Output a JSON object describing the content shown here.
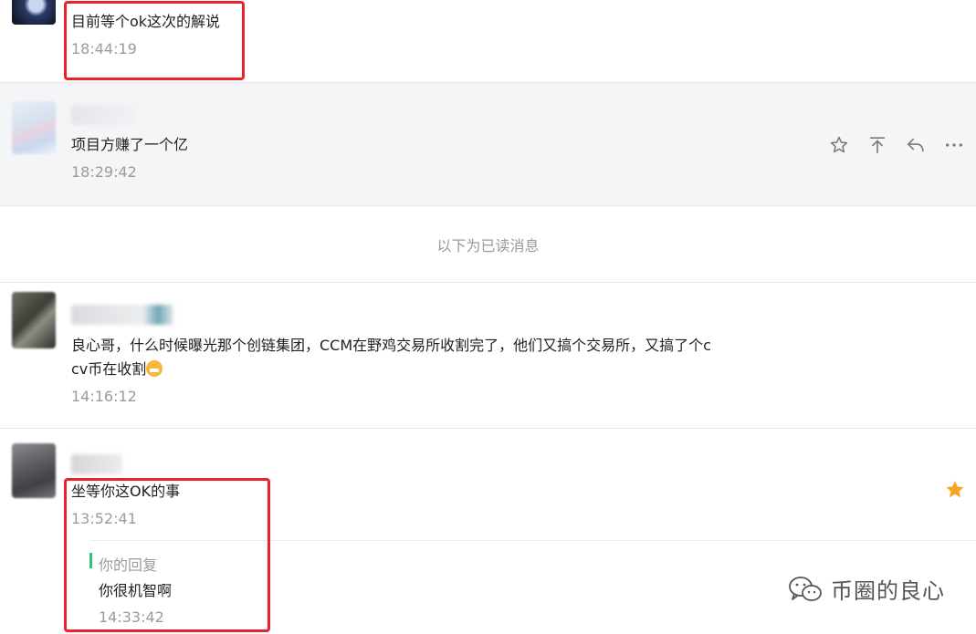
{
  "messages": [
    {
      "id": "msg1",
      "text": "目前等个ok这次的解说",
      "time": "18:44:19"
    },
    {
      "id": "msg2",
      "text": "项目方赚了一个亿",
      "time": "18:29:42"
    },
    {
      "id": "msg3",
      "text_line1": "良心哥，什么时候曝光那个创链集团，CCM在野鸡交易所收割完了，他们又搞个交易所，又搞了个c",
      "text_line2": "cv币在收割",
      "time": "14:16:12"
    },
    {
      "id": "msg4",
      "text": "坐等你这OK的事",
      "time": "13:52:41",
      "reply": {
        "label": "你的回复",
        "text": "你很机智啊",
        "time": "14:33:42"
      }
    }
  ],
  "divider": "以下为已读消息",
  "actions": [
    "star-outline-icon",
    "pin-top-icon",
    "reply-icon",
    "more-icon"
  ],
  "watermark": "币圈的良心",
  "colors": {
    "highlight": "#e8232a",
    "star": "#f5a623",
    "reply_bar": "#2ec27e",
    "time": "#9b9b9b"
  }
}
